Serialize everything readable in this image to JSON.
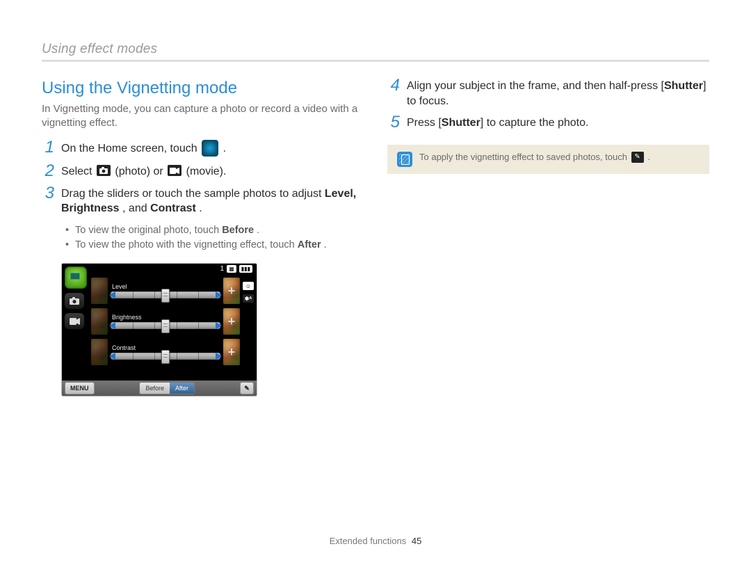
{
  "header": {
    "section": "Using effect modes"
  },
  "title": "Using the Vignetting mode",
  "intro": "In Vignetting mode, you can capture a photo or record a video with a vignetting effect.",
  "steps_left": [
    {
      "n": "1",
      "pre": "On the Home screen, touch ",
      "post": "."
    },
    {
      "n": "2",
      "pre": "Select ",
      "mid1": " (photo) or ",
      "post": " (movie)."
    },
    {
      "n": "3",
      "line1": "Drag the sliders or touch the sample photos to adjust ",
      "bold": "Level, Brightness",
      "line1b": ", and ",
      "bold2": "Contrast",
      "line1c": "."
    }
  ],
  "sub": {
    "a_pre": "To view the original photo, touch ",
    "a_bold": "Before",
    "a_post": ".",
    "b_pre": "To view the photo with the vignetting effect, touch ",
    "b_bold": "After",
    "b_post": "."
  },
  "steps_right": [
    {
      "n": "4",
      "pre": "Align your subject in the frame, and then half-press [",
      "bold": "Shutter",
      "post": "] to focus."
    },
    {
      "n": "5",
      "pre": "Press [",
      "bold": "Shutter",
      "post": "] to capture the photo."
    }
  ],
  "tip": {
    "pre": "To apply the vignetting effect to saved photos, touch ",
    "post": "."
  },
  "lcd": {
    "count": "1",
    "sliders": [
      "Level",
      "Brightness",
      "Contrast"
    ],
    "menu": "MENU",
    "before": "Before",
    "after": "After",
    "flash": "✱ᴬ"
  },
  "footer": {
    "label": "Extended functions",
    "page": "45"
  }
}
